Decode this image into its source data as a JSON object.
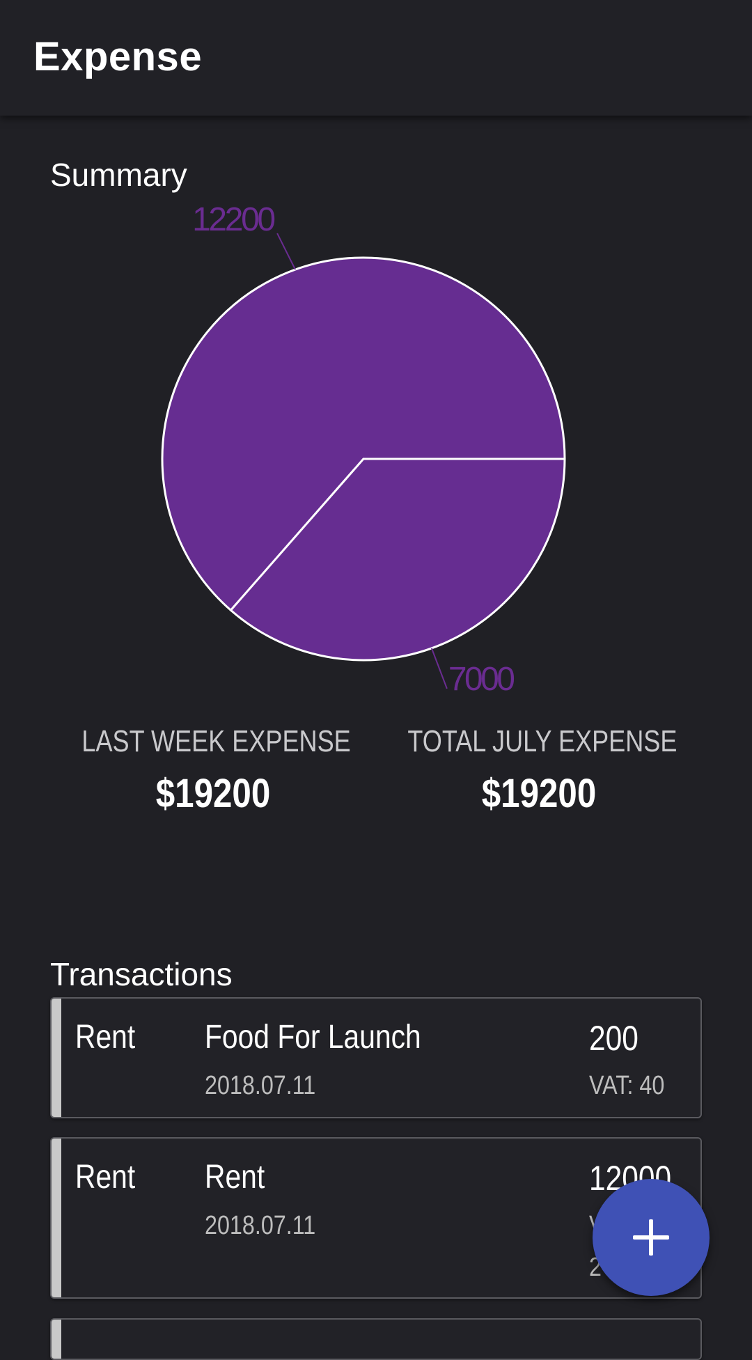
{
  "appbar": {
    "title": "Expense"
  },
  "summary": {
    "label": "Summary",
    "last_week": {
      "label": "LAST WEEK EXPENSE",
      "value": "$19200"
    },
    "month": {
      "label": "TOTAL JULY EXPENSE",
      "value": "$19200"
    }
  },
  "chart_data": {
    "type": "pie",
    "values": [
      12200,
      7000
    ],
    "labels": [
      "12200",
      "7000"
    ],
    "colors": [
      "#662d91",
      "#662d91"
    ],
    "label_color": "#6a2c91",
    "stroke_color": "#ffffff"
  },
  "transactions": {
    "label": "Transactions",
    "items": [
      {
        "category": "Rent",
        "name": "Food For Launch",
        "date": "2018.07.11",
        "amount": "200",
        "vat": "VAT: 40",
        "extra": ""
      },
      {
        "category": "Rent",
        "name": "Rent",
        "date": "2018.07.11",
        "amount": "12000",
        "vat": "V",
        "extra": "2"
      },
      {
        "category": "",
        "name": "",
        "date": "",
        "amount": "",
        "vat": "",
        "extra": ""
      }
    ]
  },
  "fab": {
    "icon": "plus-icon"
  }
}
